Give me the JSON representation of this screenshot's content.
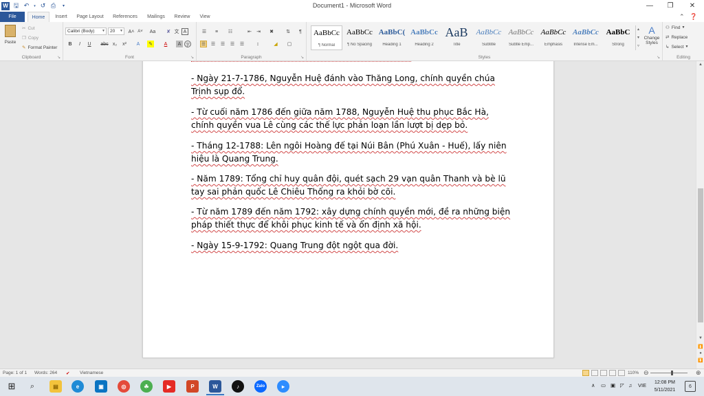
{
  "window": {
    "title": "Document1  -  Microsoft Word"
  },
  "tabs": [
    "File",
    "Home",
    "Insert",
    "Page Layout",
    "References",
    "Mailings",
    "Review",
    "View"
  ],
  "clipboard": {
    "paste": "Paste",
    "cut": "Cut",
    "copy": "Copy",
    "format_painter": "Format Painter",
    "label": "Clipboard"
  },
  "font": {
    "name": "Calibri (Body)",
    "size": "20",
    "label": "Font"
  },
  "paragraph": {
    "label": "Paragraph"
  },
  "styles": {
    "label": "Styles",
    "items": [
      {
        "sample": "AaBbCc",
        "name": "¶ Normal"
      },
      {
        "sample": "AaBbCc",
        "name": "¶ No Spacing"
      },
      {
        "sample": "AaBbC(",
        "name": "Heading 1"
      },
      {
        "sample": "AaBbCc",
        "name": "Heading 2"
      },
      {
        "sample": "AaB",
        "name": "Title"
      },
      {
        "sample": "AaBbCc",
        "name": "Subtitle"
      },
      {
        "sample": "AaBbCc",
        "name": "Subtle Emp..."
      },
      {
        "sample": "AaBbCc",
        "name": "Emphasis"
      },
      {
        "sample": "AaBbCc",
        "name": "Intense Em..."
      },
      {
        "sample": "AaBbC",
        "name": "Strong"
      }
    ],
    "change_styles": "Change Styles"
  },
  "editing": {
    "find": "Find",
    "replace": "Replace",
    "select": "Select",
    "label": "Editing"
  },
  "document": {
    "paragraphs": [
      "- Ngày 21-7-1786, Nguyễn Huệ đánh vào Thăng Long, chính quyền chúa Trịnh sụp đổ.",
      "- Từ cuối năm 1786 đến giữa năm 1788, Nguyễn Huệ thu phục Bắc Hà, chính quyền vua Lê cùng các thế lực phản loạn lần lượt bị dẹp bỏ.",
      "- Tháng 12-1788: Lên ngôi Hoàng đế tại Núi Bân (Phú Xuân - Huế), lấy niên hiệu là Quang Trung.",
      "- Năm 1789: Tổng chỉ huy quân đội, quét sạch 29 vạn quân Thanh và bè lũ tay sai phản quốc Lê Chiêu Thống ra khỏi bờ cõi.",
      "- Từ năm 1789 đến năm 1792: xây dựng chính quyền mới, đề ra những biện pháp thiết thực để khôi phục kinh tế và ổn định xã hội.",
      "- Ngày 15-9-1792: Quang Trung đột ngột qua đời."
    ]
  },
  "status": {
    "page": "Page: 1 of 1",
    "words": "Words: 264",
    "language": "Vietnamese",
    "zoom": "110%"
  },
  "taskbar": {
    "language": "VIE",
    "time": "12:08 PM",
    "date": "5/11/2021",
    "notifications": "6"
  }
}
